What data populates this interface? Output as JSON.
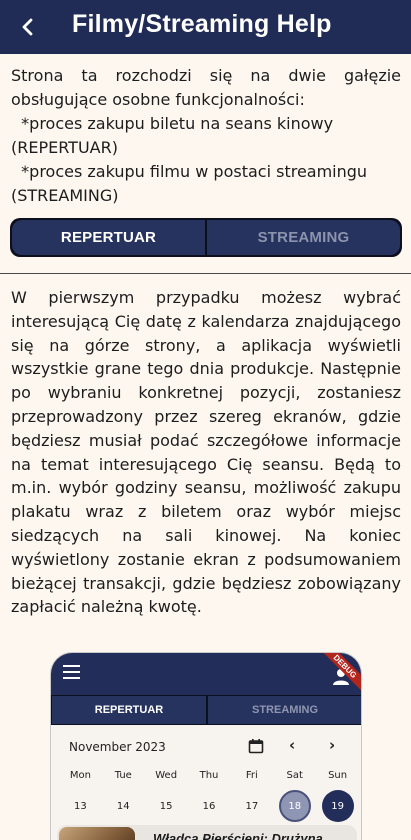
{
  "header": {
    "title": "Filmy/Streaming Help",
    "back_icon": "arrow-back-icon"
  },
  "intro": {
    "line1": "Strona ta rozchodzi się na dwie gałęzie obsługujące osobne funkcjonalności:",
    "item1": "*proces zakupu biletu na seans kinowy",
    "item1_tag": "(REPERTUAR)",
    "item2": "*proces zakupu filmu w postaci streamingu",
    "item2_tag": "(STREAMING)"
  },
  "tabs": {
    "repertuar": "REPERTUAR",
    "streaming": "STREAMING",
    "selected": "REPERTUAR"
  },
  "description": "W pierwszym przypadku możesz wybrać interesującą Cię datę z kalendarza znajdującego się na górze strony, a aplikacja wyświetli wszystkie grane tego dnia produkcje. Następnie po wybraniu konkretnej pozycji, zostaniesz przeprowadzony przez szereg ekranów, gdzie będziesz musiał podać szczegółowe informacje na temat interesującego Cię seansu. Będą to m.in. wybór godziny seansu, możliwość zakupu plakatu wraz z biletem oraz wybór miejsc siedzących na sali kinowej. Na koniec wyświetlony zostanie ekran z podsumowaniem bieżącej transakcji, gdzie będziesz zobowiązany zapłacić należną kwotę.",
  "preview": {
    "debug_banner": "DEBUG",
    "tabs": {
      "repertuar": "REPERTUAR",
      "streaming": "STREAMING"
    },
    "calendar": {
      "month": "November 2023",
      "weekdays": [
        "Mon",
        "Tue",
        "Wed",
        "Thu",
        "Fri",
        "Sat",
        "Sun"
      ],
      "dates": [
        "13",
        "14",
        "15",
        "16",
        "17",
        "18",
        "19"
      ],
      "selected_light": "18",
      "selected_dark": "19"
    },
    "movie_title": "Władca Pierścieni: Drużyna"
  },
  "colors": {
    "appbar": "#212c56",
    "background": "#fdf7f0",
    "tab_bg": "#27335f",
    "tab_inactive_text": "#8b93ad",
    "debug": "#b3261e"
  }
}
